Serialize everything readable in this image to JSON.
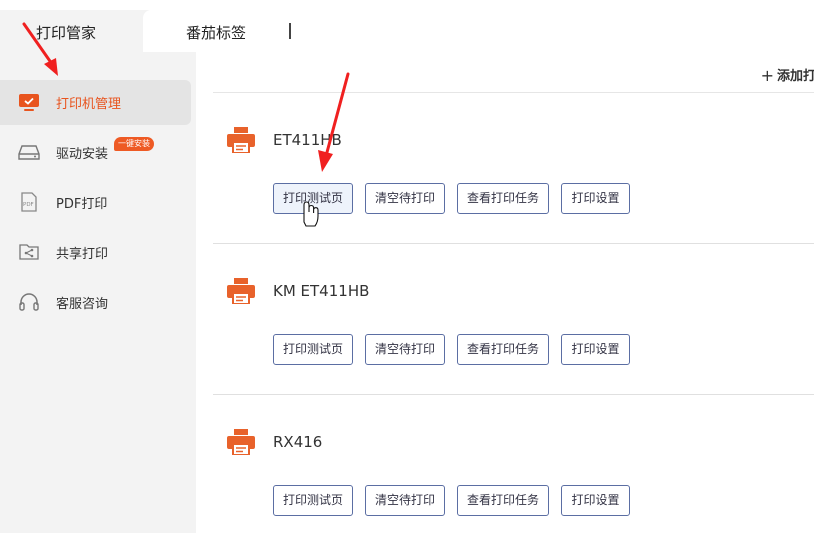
{
  "tabs": [
    {
      "label": "打印管家",
      "active": true
    },
    {
      "label": "番茄标签",
      "active": false
    }
  ],
  "sidebar": {
    "items": [
      {
        "label": "打印机管理",
        "icon": "monitor-icon",
        "active": true
      },
      {
        "label": "驱动安装",
        "icon": "drive-icon",
        "badge": "一键安装"
      },
      {
        "label": "PDF打印",
        "icon": "pdf-icon"
      },
      {
        "label": "共享打印",
        "icon": "share-folder-icon"
      },
      {
        "label": "客服咨询",
        "icon": "headset-icon"
      }
    ]
  },
  "main": {
    "add_label": "添加打",
    "printers": [
      {
        "name": "ET411HB"
      },
      {
        "name": "KM ET411HB"
      },
      {
        "name": "RX416"
      }
    ],
    "actions": {
      "test": "打印测试页",
      "clear": "清空待打印",
      "view": "查看打印任务",
      "settings": "打印设置"
    }
  },
  "colors": {
    "accent": "#e8541e",
    "printer_icon": "#e8622b",
    "button_border": "#5b6ea3",
    "annotation_arrow": "#f02020"
  }
}
